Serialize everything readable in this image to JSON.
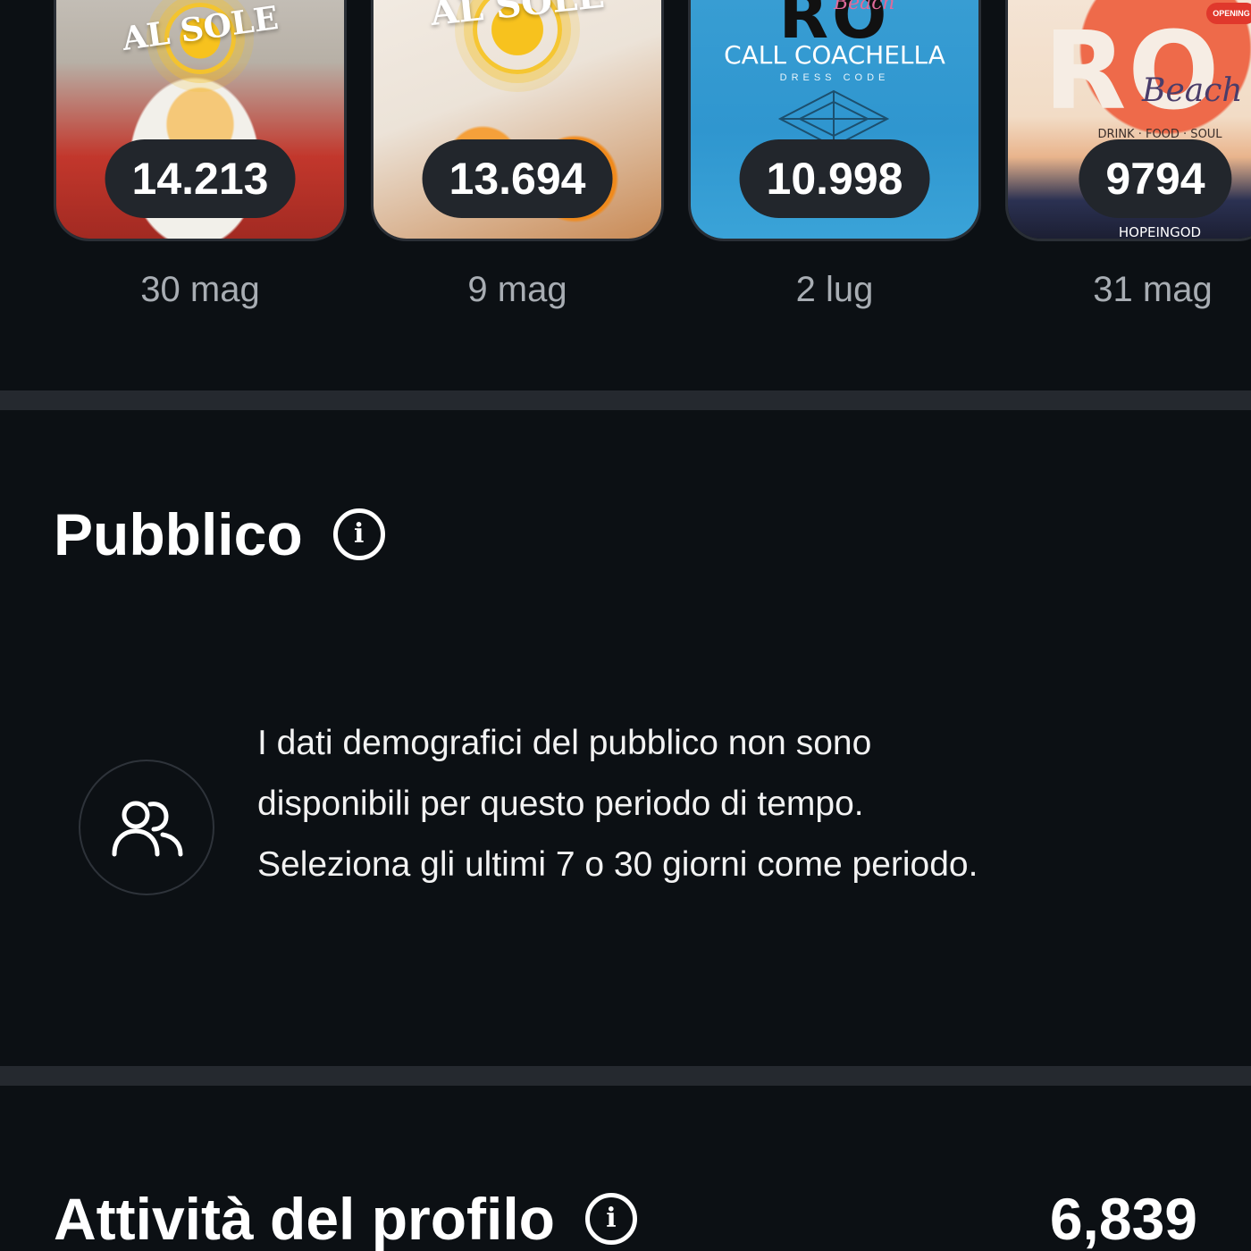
{
  "stories": [
    {
      "count": "14.213",
      "date": "30 mag",
      "poster_text": "AL SOLE"
    },
    {
      "count": "13.694",
      "date": "9 mag",
      "poster_text": "AL SOLE"
    },
    {
      "count": "10.998",
      "date": "2 lug",
      "poster_text": "RO",
      "poster_script": "Beach",
      "poster_headline": "CALL COACHELLA",
      "poster_subline": "DRESS CODE"
    },
    {
      "count": "9794",
      "date": "31 mag",
      "poster_text": "RO",
      "poster_script": "Beach",
      "poster_tagline": "DRINK · FOOD · SOUL",
      "poster_footer": "HOPEINGOD",
      "poster_badge": "OPENING"
    }
  ],
  "audience": {
    "title": "Pubblico",
    "info_icon": "info-icon",
    "icon": "users-icon",
    "message": "I dati demografici del pubblico non sono disponibili per questo periodo di tempo. Seleziona gli ultimi 7 o 30 giorni come periodo."
  },
  "profile_activity": {
    "title": "Attività del profilo",
    "info_icon": "info-icon",
    "value": "6,839"
  },
  "colors": {
    "background": "#0c1014",
    "divider": "#25292f",
    "pill": "#22262c",
    "secondary_text": "#a8adb3"
  }
}
